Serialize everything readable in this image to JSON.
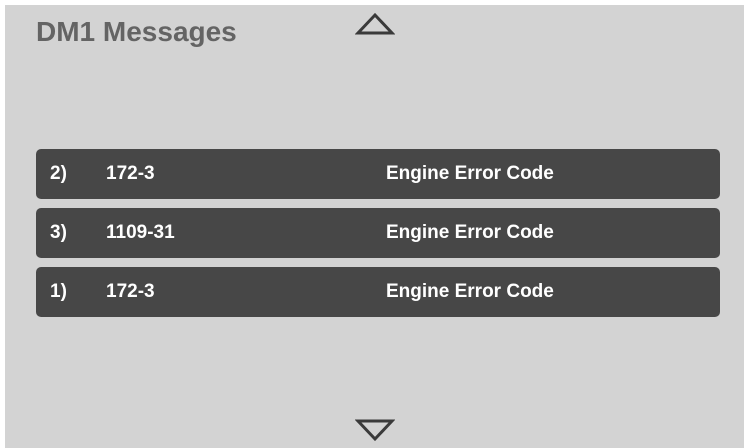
{
  "header": {
    "title": "DM1 Messages"
  },
  "nav": {
    "up_icon": "triangle-up-outline",
    "down_icon": "triangle-down-outline"
  },
  "colors": {
    "background": "#d3d3d3",
    "title": "#646464",
    "row_background": "#474747",
    "row_text": "#ffffff"
  },
  "messages": [
    {
      "index": "2)",
      "code": "172-3",
      "description": "Engine Error Code"
    },
    {
      "index": "3)",
      "code": "1109-31",
      "description": "Engine Error Code"
    },
    {
      "index": "1)",
      "code": "172-3",
      "description": "Engine Error Code"
    }
  ]
}
